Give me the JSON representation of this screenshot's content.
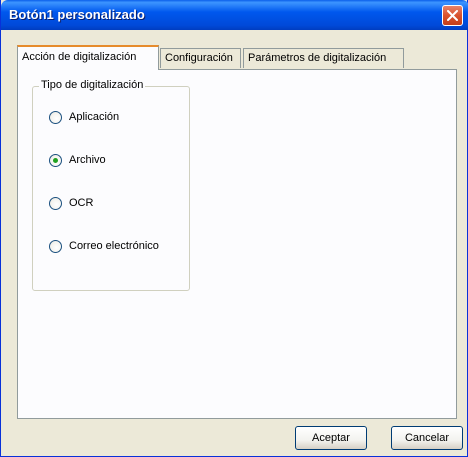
{
  "window": {
    "title": "Botón1 personalizado"
  },
  "tabs": [
    {
      "label": "Acción de digitalización",
      "active": true
    },
    {
      "label": "Configuración",
      "active": false
    },
    {
      "label": "Parámetros de digitalización",
      "active": false
    }
  ],
  "group": {
    "legend": "Tipo de digitalización",
    "options": [
      {
        "label": "Aplicación",
        "checked": false
      },
      {
        "label": "Archivo",
        "checked": true
      },
      {
        "label": "OCR",
        "checked": false
      },
      {
        "label": "Correo electrónico",
        "checked": false
      }
    ]
  },
  "buttons": {
    "ok": "Aceptar",
    "cancel": "Cancelar"
  },
  "colors": {
    "titlebar": "#0058EE",
    "close": "#D9522D",
    "tab_highlight": "#E68B2C",
    "radio_dot": "#21A121"
  }
}
